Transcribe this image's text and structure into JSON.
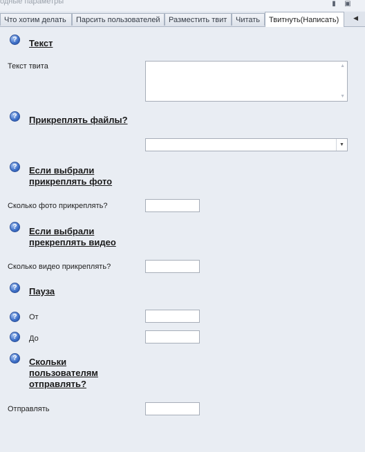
{
  "window": {
    "title": "одные параметры",
    "pin_icon": "pin-icon",
    "close_icon": "close-icon"
  },
  "tabs": [
    {
      "label": "Что хотим делать"
    },
    {
      "label": "Парсить пользователей"
    },
    {
      "label": "Разместить твит"
    },
    {
      "label": "Читать"
    },
    {
      "label": "Твитнуть(Написать)",
      "active": true
    }
  ],
  "sections": {
    "text": {
      "title": "Текст",
      "tweet_label": "Текст твита",
      "tweet_value": ""
    },
    "attach": {
      "title": "Прикреплять файлы?",
      "selected": ""
    },
    "photo": {
      "title_line1": "Если выбрали",
      "title_line2": "прикреплять фото",
      "count_label": "Сколько фото прикреплять?",
      "count_value": ""
    },
    "video": {
      "title_line1": "Если выбрали",
      "title_line2": "прекреплять видео",
      "count_label": "Сколько видео прикреплять?",
      "count_value": ""
    },
    "pause": {
      "title": "Пауза",
      "from_label": "От",
      "from_value": "",
      "to_label": "До",
      "to_value": ""
    },
    "users": {
      "title_line1": "Скольки",
      "title_line2": "пользователям",
      "title_line3": "отправлять?",
      "send_label": "Отправлять",
      "send_value": ""
    }
  },
  "colors": {
    "background": "#e9edf3",
    "help_icon": "#3d6fc7",
    "border": "#a6adb8"
  }
}
